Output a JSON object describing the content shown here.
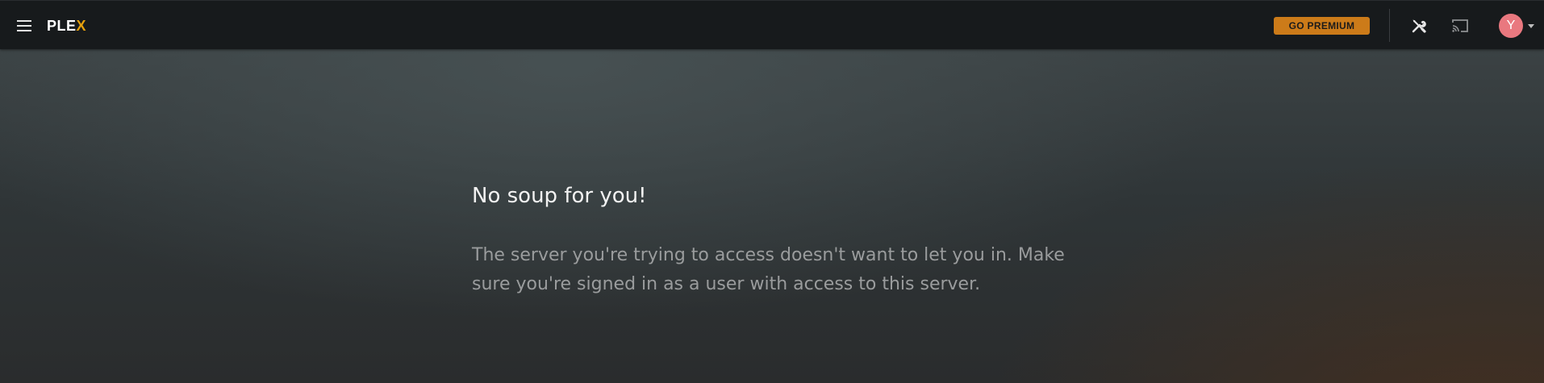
{
  "header": {
    "logo_text": "PLE",
    "logo_accent": "X",
    "premium_label": "GO PREMIUM",
    "avatar_initial": "Y",
    "icons": {
      "menu": "hamburger-menu-icon",
      "tools": "wrench-screwdriver-icon",
      "cast": "cast-icon",
      "dropdown": "caret-down-icon"
    }
  },
  "message": {
    "title": "No soup for you!",
    "body": "The server you're trying to access doesn't want to let you in. Make sure you're signed in as a user with access to this server."
  },
  "colors": {
    "topbar": "#171a1c",
    "premium_button": "#cc7b19",
    "logo_accent": "#e5a00d",
    "avatar": "#e9787f",
    "title_text": "#f2f2f2",
    "body_text": "#9a9c9d"
  }
}
